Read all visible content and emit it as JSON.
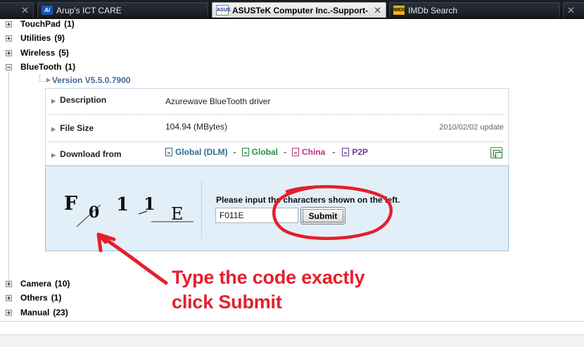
{
  "tabs": [
    {
      "label": "",
      "icon": "tab-fragment"
    },
    {
      "label": "Arup's ICT CARE",
      "icon": "ai-favicon"
    },
    {
      "label": "ASUSTeK Computer Inc.-Support-",
      "icon": "asus-favicon",
      "active": true
    },
    {
      "label": "IMDb Search",
      "icon": "imdb-favicon"
    },
    {
      "label": "",
      "icon": "tab-fragment"
    }
  ],
  "categories_top": [
    {
      "name": "TouchPad",
      "count": "(1)",
      "state": "collapsed"
    },
    {
      "name": "Utilities",
      "count": "(9)",
      "state": "collapsed"
    },
    {
      "name": "Wireless",
      "count": "(5)",
      "state": "collapsed"
    },
    {
      "name": "BlueTooth",
      "count": "(1)",
      "state": "expanded"
    }
  ],
  "version": "Version V5.5.0.7900",
  "details": {
    "description_label": "Description",
    "description_value": "Azurewave BlueTooth driver",
    "filesize_label": "File Size",
    "filesize_value": "104.94 (MBytes)",
    "update_date": "2010/02/02 update",
    "download_label": "Download from",
    "links": [
      {
        "label": "Global (DLM)",
        "color": "#2f6e8e"
      },
      {
        "label": "Global",
        "color": "#2a8a4a"
      },
      {
        "label": "China",
        "color": "#b8367a"
      },
      {
        "label": "P2P",
        "color": "#6a3a9a"
      }
    ],
    "separator": "-"
  },
  "captcha": {
    "chars": [
      "F",
      "0",
      "1",
      "1",
      "E"
    ],
    "prompt": "Please input the characters shown on the left.",
    "input_value": "F011E",
    "submit_label": "Submit"
  },
  "categories_bottom": [
    {
      "name": "Camera",
      "count": "(10)",
      "state": "collapsed"
    },
    {
      "name": "Others",
      "count": "(1)",
      "state": "collapsed"
    },
    {
      "name": "Manual",
      "count": "(23)",
      "state": "collapsed"
    }
  ],
  "annotation": {
    "line1": "Type the code exactly",
    "line2": "click Submit",
    "color": "#e51f2d"
  }
}
